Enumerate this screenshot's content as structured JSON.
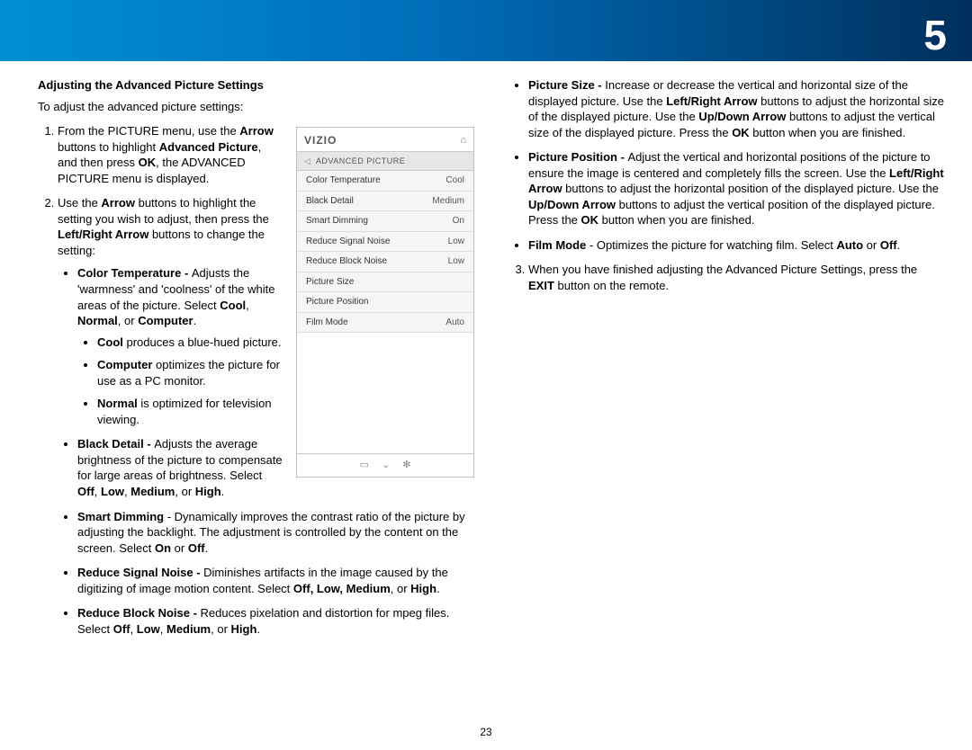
{
  "chapter": "5",
  "page_number": "23",
  "heading": "Adjusting the Advanced Picture Settings",
  "intro": "To adjust the advanced picture settings:",
  "menu": {
    "brand": "VIZIO",
    "title": "ADVANCED PICTURE",
    "rows": [
      {
        "label": "Color Temperature",
        "value": "Cool"
      },
      {
        "label": "Black Detail",
        "value": "Medium"
      },
      {
        "label": "Smart Dimming",
        "value": "On"
      },
      {
        "label": "Reduce Signal Noise",
        "value": "Low"
      },
      {
        "label": "Reduce Block Noise",
        "value": "Low"
      },
      {
        "label": "Picture Size",
        "value": ""
      },
      {
        "label": "Picture Position",
        "value": ""
      },
      {
        "label": "Film Mode",
        "value": "Auto"
      }
    ]
  },
  "col1": {
    "step1_a": "From the PICTURE menu, use the ",
    "step1_b": "Arrow",
    "step1_c": " buttons to highlight ",
    "step1_d": "Advanced Picture",
    "step1_e": ", and then press ",
    "step1_f": "OK",
    "step1_g": ", the ADVANCED PICTURE menu is displayed.",
    "step2_a": "Use the ",
    "step2_b": "Arrow",
    "step2_c": " buttons to highlight the setting you wish to adjust, then press the ",
    "step2_d": "Left/Right Arrow",
    "step2_e": " buttons to change the setting:",
    "ct_label": "Color Temperature - ",
    "ct_text_a": "Adjusts the 'warmness' and 'coolness' of the white areas of the picture. Select ",
    "ct_cool": "Cool",
    "ct_sep1": ", ",
    "ct_normal": "Normal",
    "ct_sep2": ", or ",
    "ct_computer": "Computer",
    "ct_period": ".",
    "ct_sub_cool_b": "Cool",
    "ct_sub_cool_t": " produces a blue-hued picture.",
    "ct_sub_comp_b": "Computer",
    "ct_sub_comp_t": " optimizes the picture for use as a PC monitor.",
    "ct_sub_norm_b": "Normal",
    "ct_sub_norm_t": " is optimized for television viewing.",
    "bd_label": "Black Detail - ",
    "bd_text_a": "Adjusts the average brightness of the picture to compensate for large areas of brightness. Select ",
    "bd_opts": "Off",
    "bd_s1": ", ",
    "bd_low": "Low",
    "bd_s2": ", ",
    "bd_med": "Medium",
    "bd_s3": ", or ",
    "bd_high": "High",
    "bd_period": ".",
    "sd_label": "Smart Dimming",
    "sd_text": " - Dynamically improves the contrast ratio of the picture by adjusting the backlight. The adjustment is controlled by the content on the screen. Select ",
    "sd_on": "On",
    "sd_or": " or ",
    "sd_off": "Off",
    "sd_period": ".",
    "rsn_label": "Reduce Signal Noise - ",
    "rsn_text": "Diminishes artifacts in the image caused by the digitizing of image motion content. Select ",
    "rsn_opts": "Off, Low, Medium",
    "rsn_or": ", or ",
    "rsn_high": "High",
    "rsn_period": ".",
    "rbn_label": "Reduce Block Noise - ",
    "rbn_text": "Reduces pixelation and distortion for mpeg files. Select ",
    "rbn_opts": "Off",
    "rbn_s1": ", ",
    "rbn_low": "Low",
    "rbn_s2": ", ",
    "rbn_med": "Medium",
    "rbn_s3": ", or ",
    "rbn_high": "High",
    "rbn_period": "."
  },
  "col2": {
    "ps_label": "Picture Size - ",
    "ps_text_a": "Increase or decrease the vertical and horizontal size of the displayed picture. Use the ",
    "ps_lr": "Left/Right Arrow",
    "ps_text_b": " buttons to adjust the horizontal size of the displayed picture. Use the ",
    "ps_ud": "Up/Down Arrow",
    "ps_text_c": " buttons to adjust the vertical size of the displayed picture. Press the ",
    "ps_ok": "OK",
    "ps_text_d": " button when you are finished.",
    "pp_label": "Picture Position - ",
    "pp_text_a": "Adjust the vertical and horizontal positions of the picture to ensure the image is centered and completely fills the screen. Use the ",
    "pp_lr": "Left/Right Arrow",
    "pp_text_b": " buttons to adjust the horizontal position of the displayed picture. Use the ",
    "pp_ud": "Up/Down Arrow",
    "pp_text_c": " buttons to adjust the vertical position of the displayed picture. Press the ",
    "pp_ok": "OK",
    "pp_text_d": " button when you are finished.",
    "fm_label": "Film Mode",
    "fm_text": " - Optimizes the picture for watching film. Select ",
    "fm_auto": "Auto",
    "fm_or": " or ",
    "fm_off": "Off",
    "fm_period": ".",
    "step3_a": "When you have finished adjusting the Advanced Picture Settings, press the ",
    "step3_b": "EXIT",
    "step3_c": " button on the remote."
  }
}
